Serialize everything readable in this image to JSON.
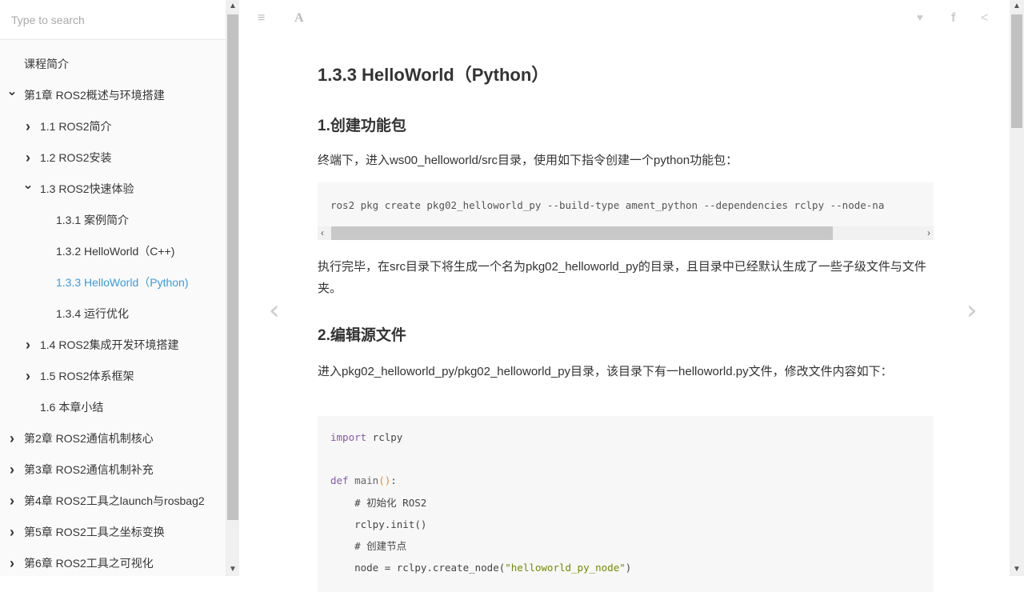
{
  "sidebar": {
    "search_placeholder": "Type to search",
    "items": [
      {
        "label": "课程简介",
        "level": 0,
        "chevron": ""
      },
      {
        "label": "第1章 ROS2概述与环境搭建",
        "level": 0,
        "chevron": "down"
      },
      {
        "label": "1.1 ROS2简介",
        "level": 1,
        "chevron": "right"
      },
      {
        "label": "1.2 ROS2安装",
        "level": 1,
        "chevron": "right"
      },
      {
        "label": "1.3 ROS2快速体验",
        "level": 1,
        "chevron": "down"
      },
      {
        "label": "1.3.1 案例简介",
        "level": 2,
        "chevron": ""
      },
      {
        "label": "1.3.2 HelloWorld（C++)",
        "level": 2,
        "chevron": ""
      },
      {
        "label": "1.3.3 HelloWorld（Python)",
        "level": 2,
        "chevron": "",
        "active": true
      },
      {
        "label": "1.3.4 运行优化",
        "level": 2,
        "chevron": ""
      },
      {
        "label": "1.4 ROS2集成开发环境搭建",
        "level": 1,
        "chevron": "right"
      },
      {
        "label": "1.5 ROS2体系框架",
        "level": 1,
        "chevron": "right"
      },
      {
        "label": "1.6 本章小结",
        "level": 1,
        "chevron": ""
      },
      {
        "label": "第2章 ROS2通信机制核心",
        "level": 0,
        "chevron": "right"
      },
      {
        "label": "第3章 ROS2通信机制补充",
        "level": 0,
        "chevron": "right"
      },
      {
        "label": "第4章 ROS2工具之launch与rosbag2",
        "level": 0,
        "chevron": "right"
      },
      {
        "label": "第5章 ROS2工具之坐标变换",
        "level": 0,
        "chevron": "right"
      },
      {
        "label": "第6章 ROS2工具之可视化",
        "level": 0,
        "chevron": "right"
      }
    ]
  },
  "toolbar": {
    "menu_icon": "≡",
    "font_icon": "A",
    "twitter": "🐦",
    "facebook": "f",
    "share": "<"
  },
  "content": {
    "title": "1.3.3 HelloWorld（Python）",
    "h_create": "1.创建功能包",
    "p1": "终端下，进入ws00_helloworld/src目录，使用如下指令创建一个python功能包：",
    "cmd": "ros2 pkg create pkg02_helloworld_py --build-type ament_python --dependencies rclpy --node-na",
    "p2": "执行完毕，在src目录下将生成一个名为pkg02_helloworld_py的目录，且目录中已经默认生成了一些子级文件与文件夹。",
    "h_edit": "2.编辑源文件",
    "p3": "进入pkg02_helloworld_py/pkg02_helloworld_py目录，该目录下有一helloworld.py文件，修改文件内容如下：",
    "code": {
      "l1a": "import",
      "l1b": " rclpy",
      "l3a": "def",
      "l3b": " main",
      "l3c": "()",
      "l3d": ":",
      "l4": "    # 初始化 ROS2",
      "l5": "    rclpy.init()",
      "l6": "    # 创建节点",
      "l7a": "    node = rclpy.create_node(",
      "l7b": "\"helloworld_py_node\"",
      "l7c": ")"
    }
  },
  "nav": {
    "prev": "‹",
    "next": "›"
  }
}
